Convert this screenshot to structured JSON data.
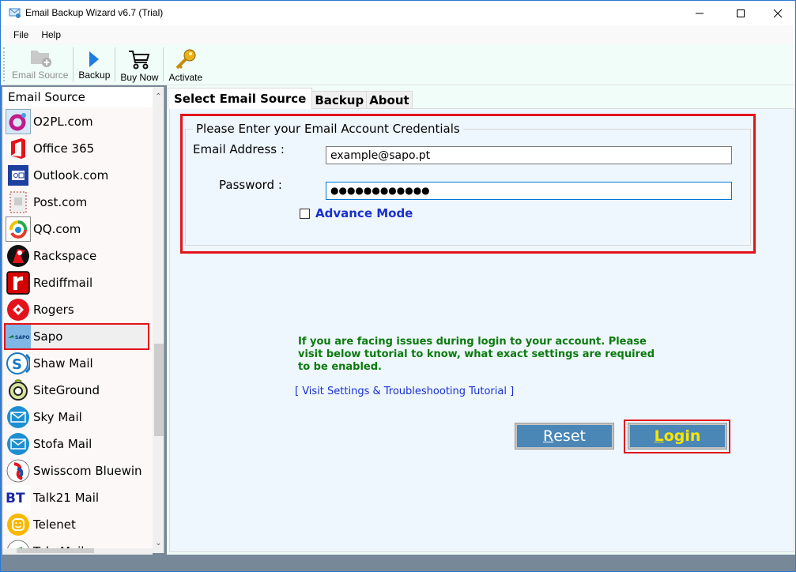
{
  "window": {
    "title": "Email Backup Wizard v6.7 (Trial)",
    "controls": {
      "minimize": "—",
      "maximize": "☐",
      "close": "✕"
    }
  },
  "menu": [
    "File",
    "Help"
  ],
  "toolbar": {
    "items": [
      {
        "label": "Email Source",
        "icon": "folder-add-icon",
        "enabled": false
      },
      {
        "label": "Backup",
        "icon": "play-icon",
        "enabled": true
      },
      {
        "label": "Buy Now",
        "icon": "cart-icon",
        "enabled": true
      },
      {
        "label": "Activate",
        "icon": "key-icon",
        "enabled": true
      }
    ]
  },
  "sidebar": {
    "header": "Email Source",
    "selected": "Sapo",
    "items": [
      {
        "label": "O2PL.com",
        "icon": "o2pl-icon"
      },
      {
        "label": "Office 365",
        "icon": "office365-icon"
      },
      {
        "label": "Outlook.com",
        "icon": "outlook-icon"
      },
      {
        "label": "Post.com",
        "icon": "postcom-icon"
      },
      {
        "label": "QQ.com",
        "icon": "qq-icon"
      },
      {
        "label": "Rackspace",
        "icon": "rackspace-icon"
      },
      {
        "label": "Rediffmail",
        "icon": "rediffmail-icon"
      },
      {
        "label": "Rogers",
        "icon": "rogers-icon"
      },
      {
        "label": "Sapo",
        "icon": "sapo-icon"
      },
      {
        "label": "Shaw Mail",
        "icon": "shaw-icon"
      },
      {
        "label": "SiteGround",
        "icon": "siteground-icon"
      },
      {
        "label": "Sky Mail",
        "icon": "mail-envelope-icon"
      },
      {
        "label": "Stofa Mail",
        "icon": "mail-envelope-icon"
      },
      {
        "label": "Swisscom Bluewin",
        "icon": "swisscom-icon"
      },
      {
        "label": "Talk21 Mail",
        "icon": "bt-icon"
      },
      {
        "label": "Telenet",
        "icon": "telenet-icon"
      },
      {
        "label": "Tele Mail",
        "icon": "generic-mail-icon"
      }
    ]
  },
  "tabs": [
    {
      "label": "Select Email Source",
      "active": true
    },
    {
      "label": "Backup",
      "active": false
    },
    {
      "label": "About",
      "active": false
    }
  ],
  "form": {
    "legend": "Please Enter your Email Account Credentials",
    "email_label": "Email Address :",
    "email_value": "example@sapo.pt",
    "password_label": "Password :",
    "password_value": "●●●●●●●●●●●●",
    "advance_mode_label": "Advance Mode",
    "advance_mode_checked": false
  },
  "help": {
    "text": "If you are facing issues during login to your account. Please visit below tutorial to know, what exact settings are required to be enabled.",
    "link": "[ Visit Settings & Troubleshooting Tutorial ]"
  },
  "buttons": {
    "reset": {
      "first": "R",
      "rest": "eset"
    },
    "login": {
      "first": "L",
      "rest": "ogin"
    }
  },
  "colors": {
    "highlight_red": "#e3131b",
    "button_blue": "#4a86b6",
    "login_yellow": "#f9e600",
    "help_green": "#0c7a0c",
    "link_blue": "#1a2fd0"
  }
}
